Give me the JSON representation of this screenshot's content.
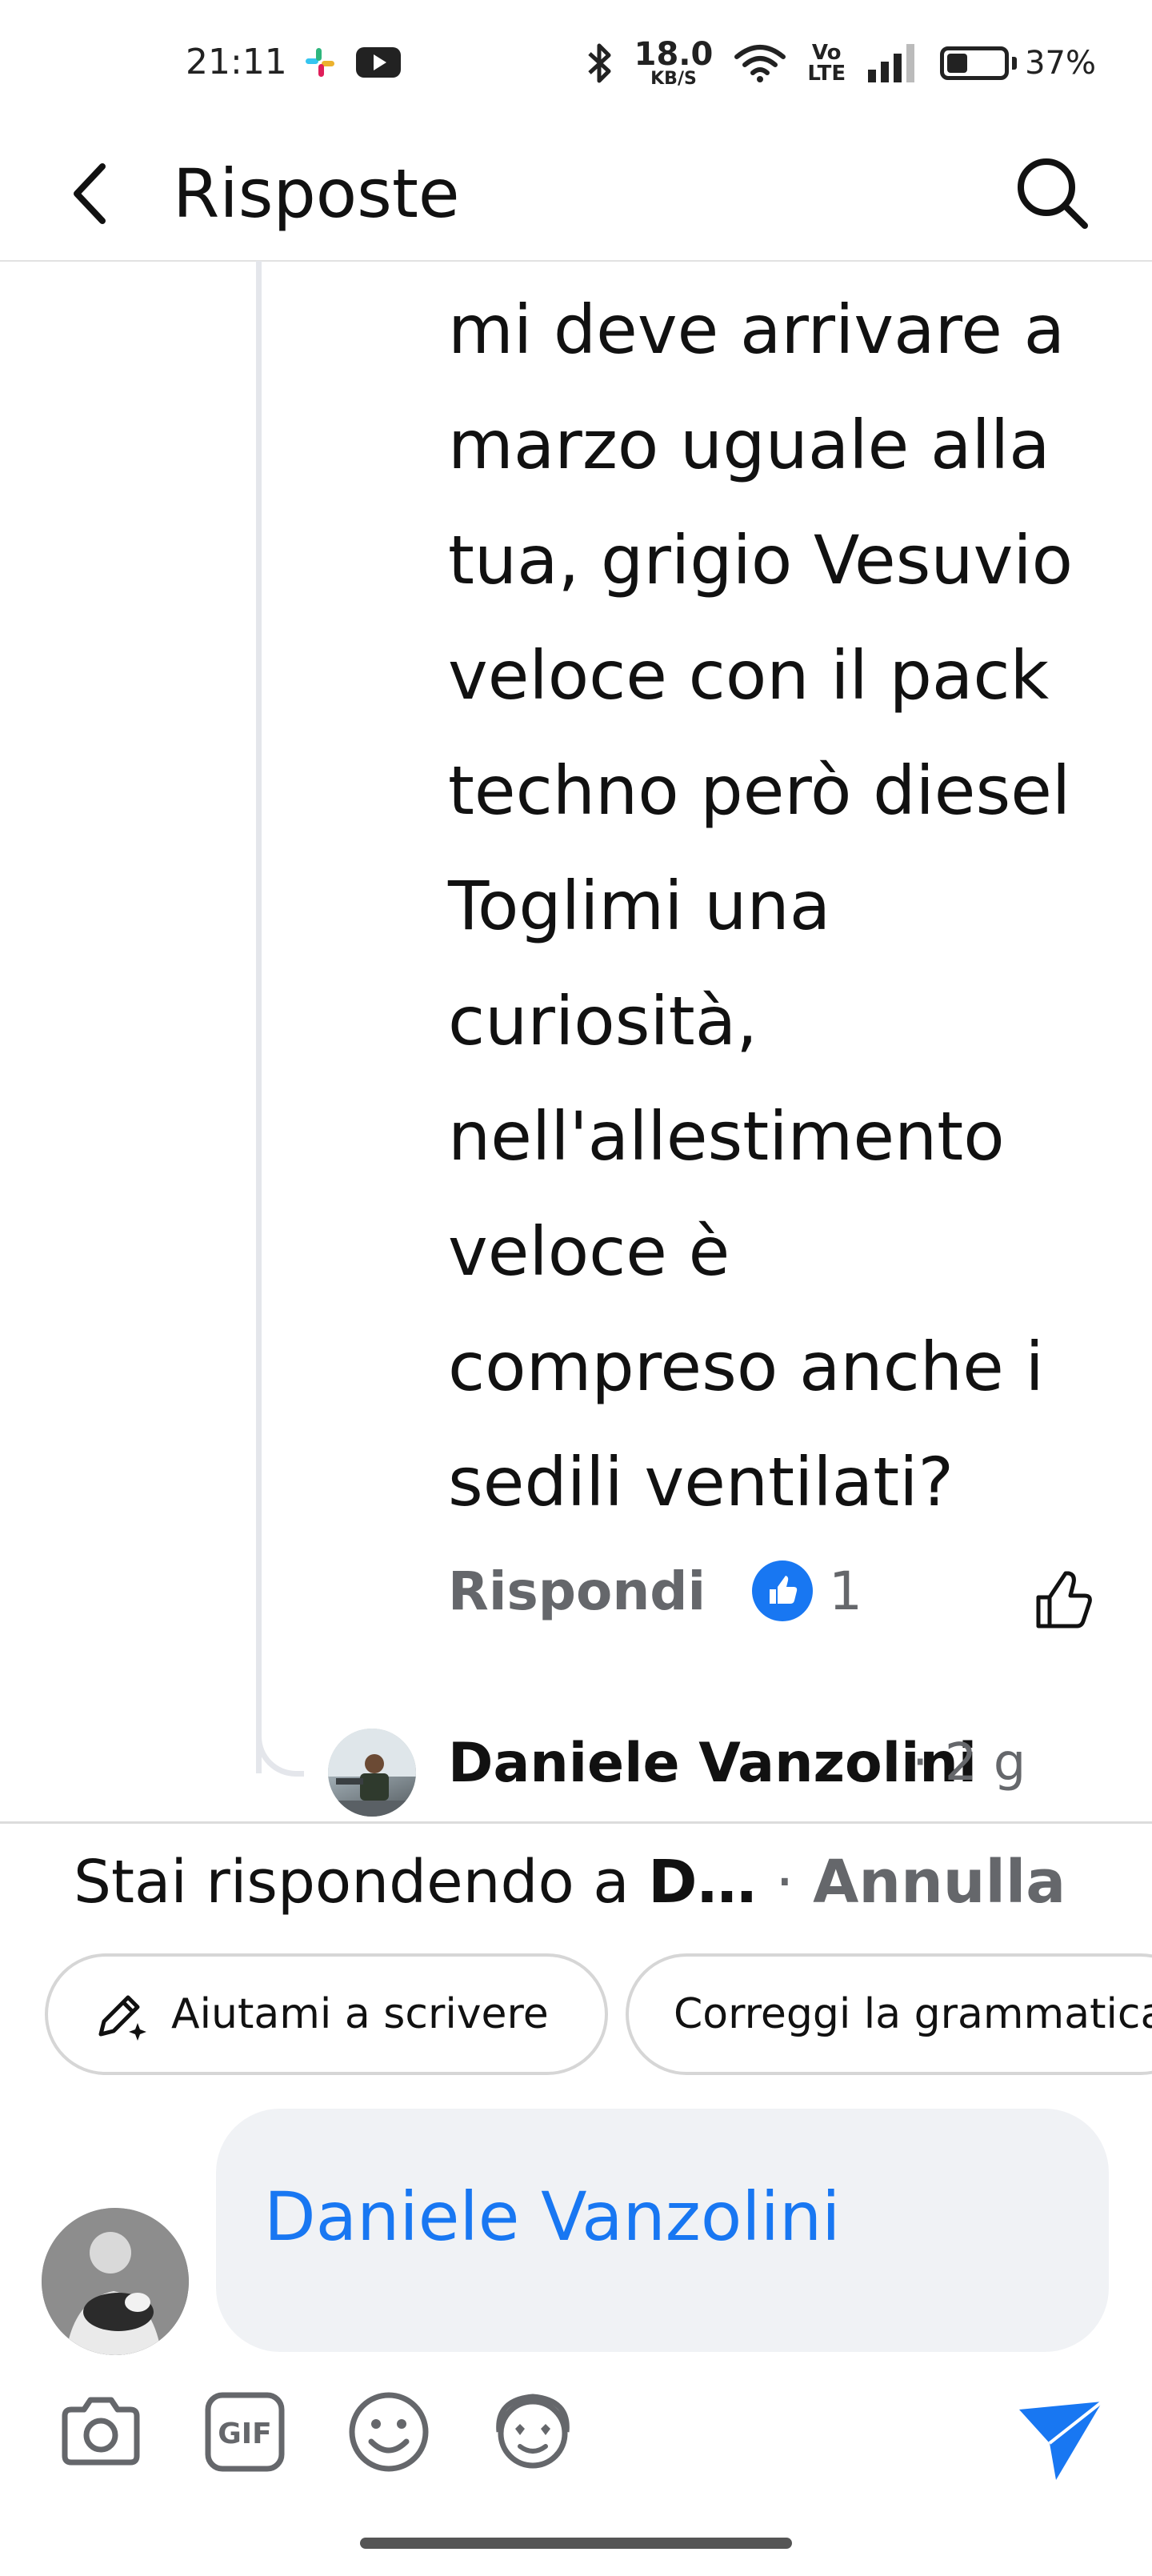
{
  "status_bar": {
    "time": "21:11",
    "speed_value": "18.0",
    "speed_unit": "KB/S",
    "volte_top": "Vo",
    "volte_bottom": "LTE",
    "battery_percent": "37%",
    "battery_level": 0.37
  },
  "header": {
    "title": "Risposte"
  },
  "comment": {
    "text": "mi deve arrivare a\nmarzo uguale alla\ntua, grigio Vesuvio\nveloce con il pack\ntechno però diesel\nToglimi una\ncuriosità,\nnell'allestimento\nveloce è\ncompreso anche i\nsedili ventilati?",
    "reply_label": "Rispondi",
    "like_count": "1"
  },
  "next_reply": {
    "author": "Daniele Vanzolini",
    "time": "· 2 g"
  },
  "composer": {
    "replying_prefix": "Stai rispondendo a ",
    "replying_name": "D…",
    "separator": " · ",
    "cancel_label": "Annulla",
    "chips": [
      "Aiutami a scrivere",
      "Correggi la grammatica"
    ],
    "mention": "Daniele Vanzolini"
  },
  "icons": {
    "back": "back-arrow-icon",
    "search": "search-icon",
    "camera": "camera-icon",
    "gif": "gif-icon",
    "emoji": "emoji-icon",
    "avatar_sticker": "avatar-sticker-icon",
    "send": "send-icon"
  },
  "colors": {
    "accent": "#1877f2",
    "secondary_text": "#65676b"
  }
}
